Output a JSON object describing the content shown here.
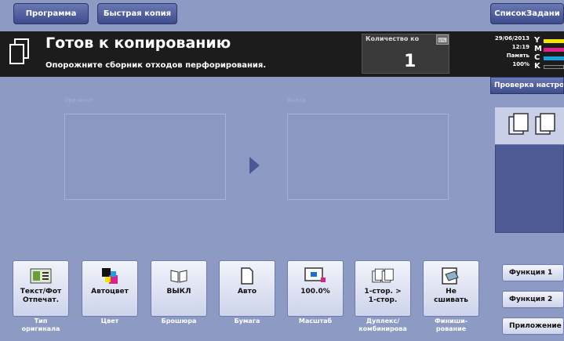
{
  "tabs": {
    "program": "Программа",
    "quick_copy": "Быстрая копия",
    "job_list": "СписокЗадани"
  },
  "status": {
    "title": "Готов к копированию",
    "message": "Опорожните сборник отходов перфорирования.",
    "count_label": "Количество ко",
    "count_value": "1",
    "datetime": "29/06/2013",
    "time": "12:19",
    "memory_label": "Память",
    "memory_value": "100%",
    "toner": [
      {
        "letter": "Y",
        "color": "#f2e600"
      },
      {
        "letter": "M",
        "color": "#e0208a"
      },
      {
        "letter": "C",
        "color": "#1aa0e0"
      },
      {
        "letter": "K",
        "color": "#202020"
      }
    ]
  },
  "check_settings": "Проверка настро",
  "preview": {
    "original_label": "Оригинал",
    "output_label": "Вывод"
  },
  "functions": [
    {
      "value": "Текст/Фот\nОтпечат.",
      "caption": "Тип\nоригинала",
      "icon": "text-photo-icon"
    },
    {
      "value": "Автоцвет",
      "caption": "Цвет",
      "icon": "color-icon"
    },
    {
      "value": "ВЫКЛ",
      "caption": "Брошюра",
      "icon": "booklet-icon"
    },
    {
      "value": "Авто",
      "caption": "Бумага",
      "icon": "paper-icon"
    },
    {
      "value": "100.0%",
      "caption": "Масштаб",
      "icon": "zoom-icon"
    },
    {
      "value": "1-стор. >\n1-стор.",
      "caption": "Дуплекс/\nкомбинирова",
      "icon": "duplex-icon"
    },
    {
      "value": "Не\nсшивать",
      "caption": "Финиши-\nрование",
      "icon": "finishing-icon"
    }
  ],
  "side_buttons": {
    "function1": "Функция 1",
    "function2": "Функция 2",
    "applications": "Приложение"
  }
}
